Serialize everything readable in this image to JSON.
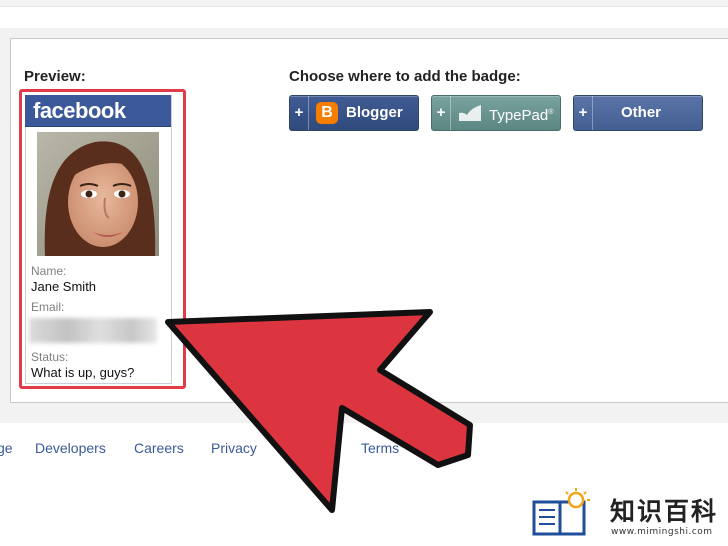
{
  "preview": {
    "heading": "Preview:",
    "badge": {
      "brand": "facebook",
      "name_label": "Name:",
      "name_value": "Jane Smith",
      "email_label": "Email:",
      "status_label": "Status:",
      "status_value": "What is up, guys?"
    }
  },
  "destinations": {
    "heading": "Choose where to add the badge:",
    "buttons": [
      {
        "plus": "+",
        "label": "Blogger",
        "icon": "blogger-icon",
        "icon_text": "B"
      },
      {
        "plus": "+",
        "label": "TypePad",
        "icon": "typepad-icon",
        "suffix": "®"
      },
      {
        "plus": "+",
        "label": "Other"
      }
    ]
  },
  "footer": {
    "links": [
      "ge",
      "Developers",
      "Careers",
      "Privacy",
      "Terms"
    ]
  },
  "watermark": {
    "brand_cn": "知识百科",
    "url": "www.mimingshi.com"
  },
  "colors": {
    "facebook_blue": "#3b5998",
    "highlight_red": "#e23b48",
    "arrow_red": "#dc3540",
    "blogger_orange": "#f57d00"
  }
}
